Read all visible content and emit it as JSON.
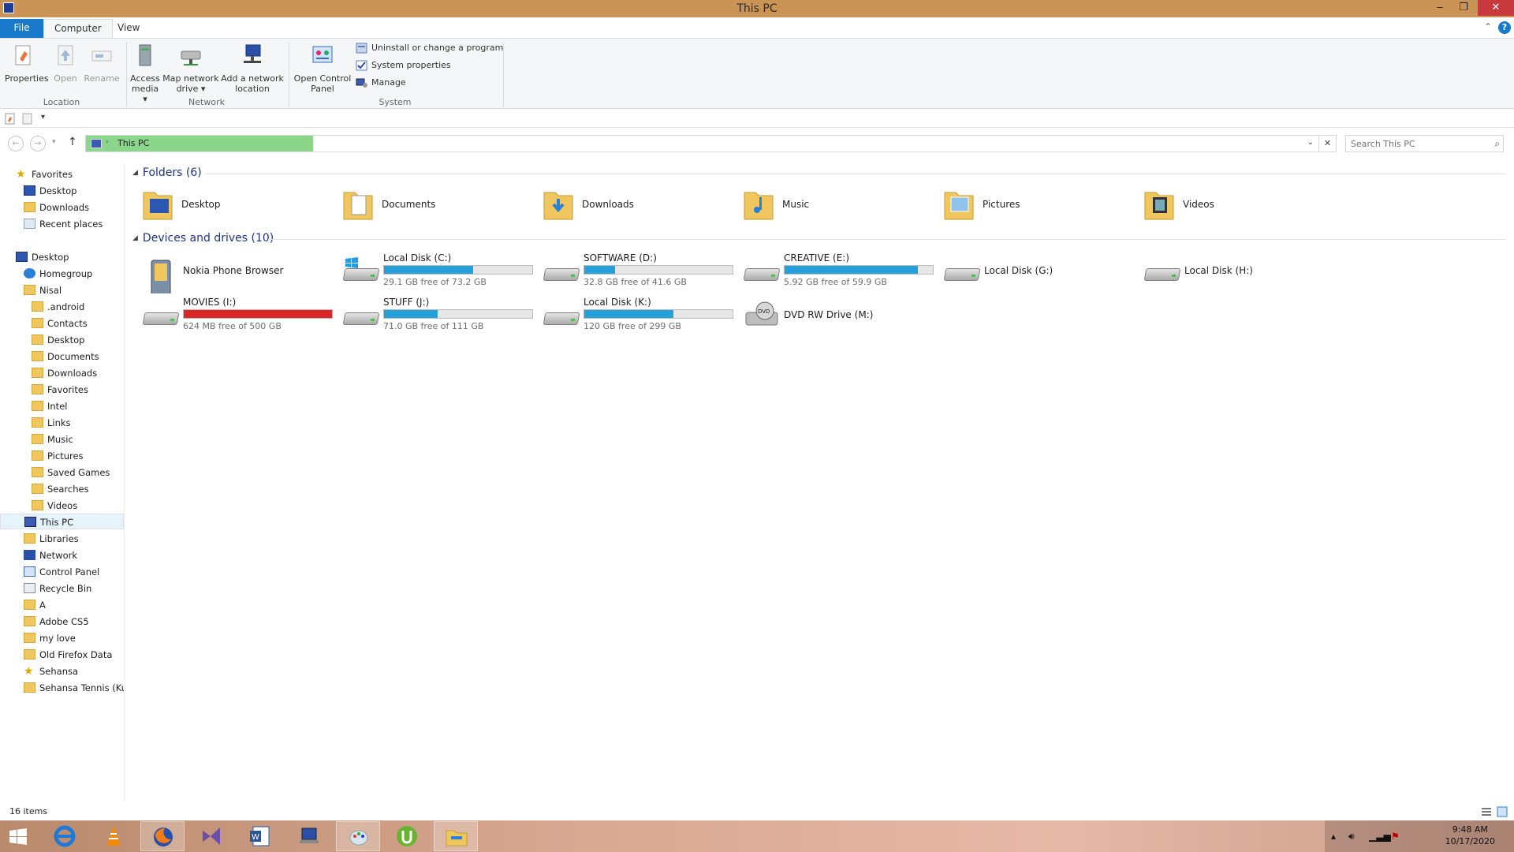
{
  "window": {
    "title": "This PC",
    "minimize": "‒",
    "maximize": "❐",
    "close": "✕"
  },
  "tabs": {
    "file": "File",
    "computer": "Computer",
    "view": "View"
  },
  "ribbon": {
    "location": {
      "label": "Location",
      "properties": "Properties",
      "open": "Open",
      "rename": "Rename"
    },
    "network": {
      "label": "Network",
      "access_media": "Access media ▾",
      "map_drive": "Map network drive ▾",
      "add_location": "Add a network location"
    },
    "system": {
      "label": "System",
      "open_control_panel": "Open Control Panel",
      "uninstall": "Uninstall or change a program",
      "system_properties": "System properties",
      "manage": "Manage"
    }
  },
  "address": {
    "path": "This PC",
    "search_placeholder": "Search This PC"
  },
  "nav": {
    "favorites": "Favorites",
    "fav_items": [
      "Desktop",
      "Downloads",
      "Recent places"
    ],
    "desktop": "Desktop",
    "homegroup": "Homegroup",
    "user": "Nisal",
    "user_items": [
      ".android",
      "Contacts",
      "Desktop",
      "Documents",
      "Downloads",
      "Favorites",
      "Intel",
      "Links",
      "Music",
      "Pictures",
      "Saved Games",
      "Searches",
      "Videos"
    ],
    "this_pc": "This PC",
    "libraries": "Libraries",
    "network": "Network",
    "control_panel": "Control Panel",
    "recycle_bin": "Recycle Bin",
    "extra_items": [
      "A",
      "Adobe CS5",
      "my love",
      "Old Firefox Data",
      "Sehansa",
      "Sehansa Tennis (Kur"
    ]
  },
  "folders": {
    "heading": "Folders (6)",
    "items": [
      "Desktop",
      "Documents",
      "Downloads",
      "Music",
      "Pictures",
      "Videos"
    ]
  },
  "drives": {
    "heading": "Devices and drives (10)",
    "items": [
      {
        "name": "Nokia Phone Browser"
      },
      {
        "name": "Local Disk (C:)",
        "free": "29.1 GB free of 73.2 GB",
        "used_fraction": 0.6
      },
      {
        "name": "SOFTWARE (D:)",
        "free": "32.8 GB free of 41.6 GB",
        "used_fraction": 0.21
      },
      {
        "name": "CREATIVE (E:)",
        "free": "5.92 GB free of 59.9 GB",
        "used_fraction": 0.9
      },
      {
        "name": "Local Disk (G:)"
      },
      {
        "name": "Local Disk (H:)"
      },
      {
        "name": "MOVIES (I:)",
        "free": "624 MB free of 500 GB",
        "used_fraction": 0.999
      },
      {
        "name": "STUFF (J:)",
        "free": "71.0 GB free of 111 GB",
        "used_fraction": 0.36
      },
      {
        "name": "Local Disk (K:)",
        "free": "120 GB free of 299 GB",
        "used_fraction": 0.6
      },
      {
        "name": "DVD RW Drive (M:)"
      }
    ]
  },
  "status": {
    "items": "16 items"
  },
  "clock": {
    "time": "9:48 AM",
    "date": "10/17/2020"
  },
  "colors": {
    "title_bar": "#c99456",
    "file_tab": "#1979ca",
    "bar_ok": "#26a0da",
    "bar_full": "#da2626",
    "progress": "#8cd68c"
  }
}
